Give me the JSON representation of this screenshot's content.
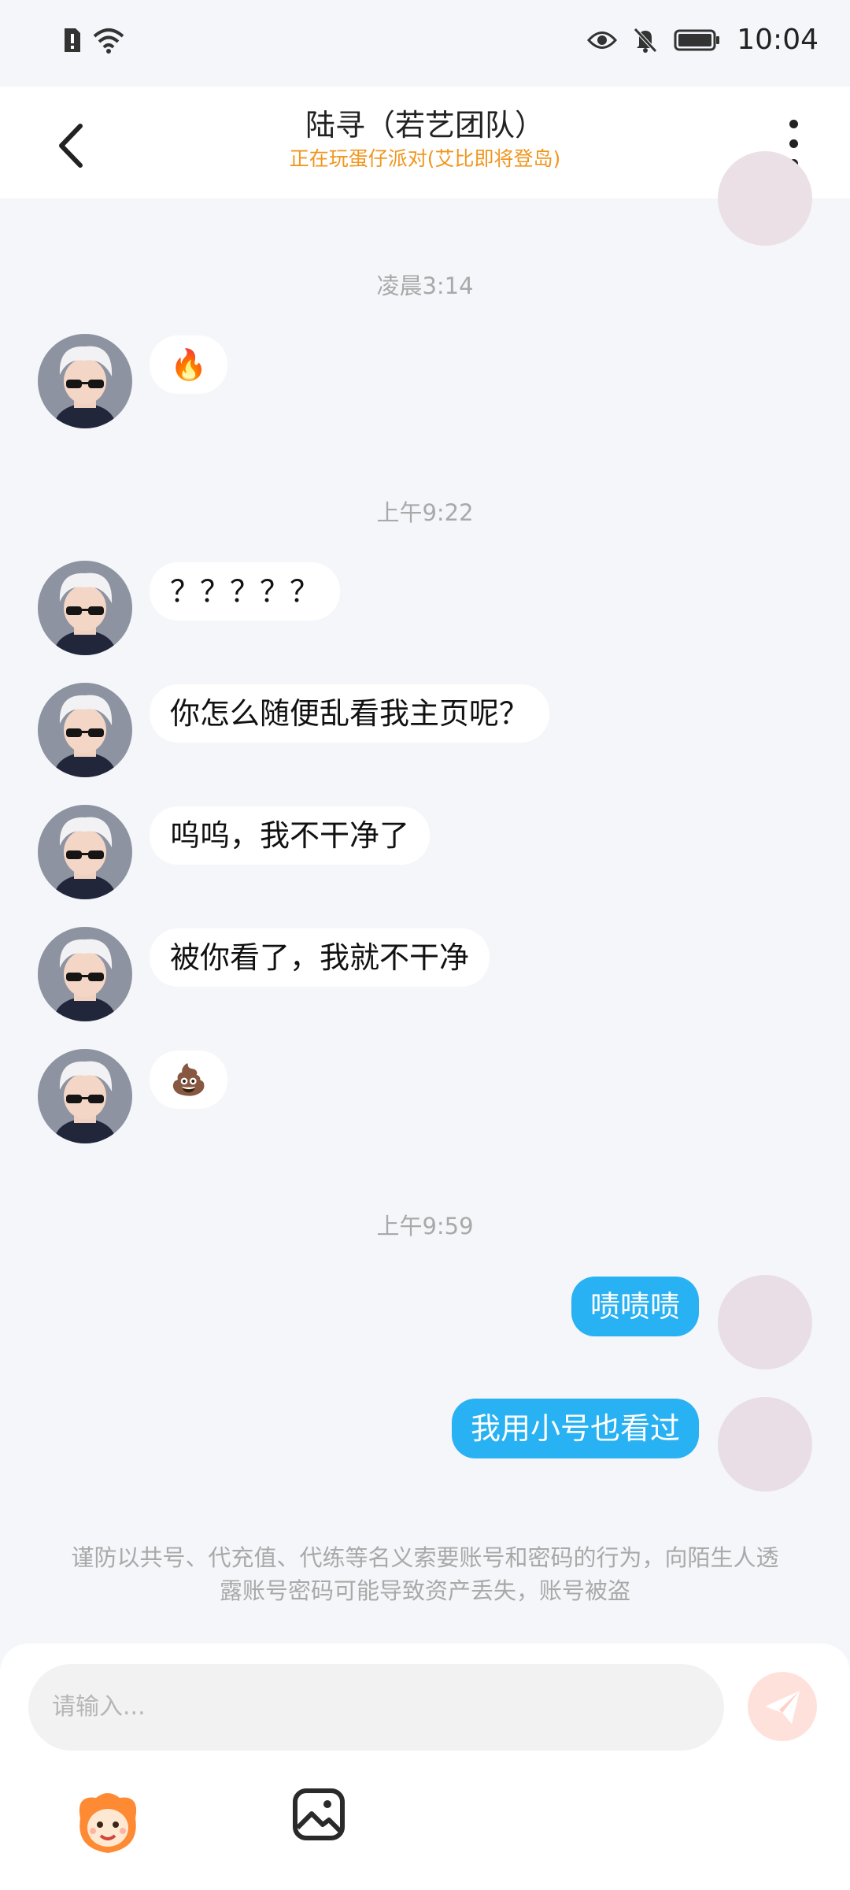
{
  "status_bar": {
    "time": "10:04"
  },
  "header": {
    "title": "陆寻（若艺团队）",
    "subtitle": "正在玩蛋仔派对(艾比即将登岛)"
  },
  "chat": {
    "timestamps": [
      "凌晨3:14",
      "上午9:22",
      "上午9:59"
    ],
    "incoming": [
      "🔥",
      "？？？？？",
      "你怎么随便乱看我主页呢？",
      "呜呜，我不干净了",
      "被你看了，我就不干净",
      "💩"
    ],
    "outgoing": [
      "啧啧啧",
      "我用小号也看过"
    ]
  },
  "notice": "谨防以共号、代充值、代练等名义索要账号和密码的行为，向陌生人透露账号密码可能导致资产丢失，账号被盗",
  "input": {
    "placeholder": "请输入..."
  },
  "colors": {
    "accent_blue": "#28b1f3",
    "subtitle_orange": "#f0961e",
    "send_disabled": "#ffe1dc"
  }
}
